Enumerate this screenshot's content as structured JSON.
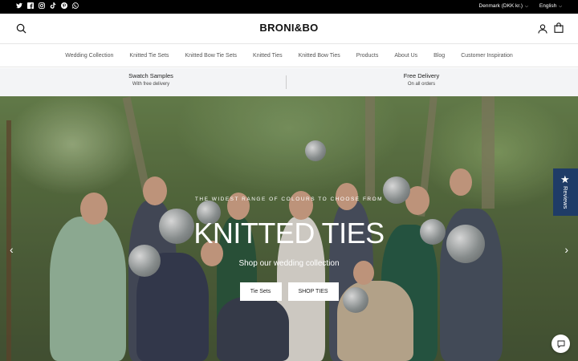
{
  "topbar": {
    "socials": [
      "twitter-icon",
      "facebook-icon",
      "instagram-icon",
      "tiktok-icon",
      "pinterest-icon",
      "whatsapp-icon"
    ],
    "country": "Denmark (DKK kr.)",
    "language": "English"
  },
  "header": {
    "logo": "BRONI&BO"
  },
  "nav": {
    "items": [
      "Wedding Collection",
      "Knitted Tie Sets",
      "Knitted Bow Tie Sets",
      "Knitted Ties",
      "Knitted Bow Ties",
      "Products",
      "About Us",
      "Blog",
      "Customer Inspiration"
    ]
  },
  "features": [
    {
      "title": "Swatch Samples",
      "subtitle": "With free delivery"
    },
    {
      "title": "Free Delivery",
      "subtitle": "On all orders"
    }
  ],
  "hero": {
    "eyebrow": "THE WIDEST RANGE OF COLOURS TO CHOOSE FROM",
    "headline": "KNITTED TIES",
    "subheadline": "Shop our wedding collection",
    "button_primary": "Tie Sets",
    "button_secondary": "SHOP TIES"
  },
  "reviews_tab": {
    "label": "Reviews"
  },
  "colors": {
    "topbar_bg": "#000000",
    "features_bg": "#f3f4f6",
    "reviews_bg": "#1f3c67"
  }
}
